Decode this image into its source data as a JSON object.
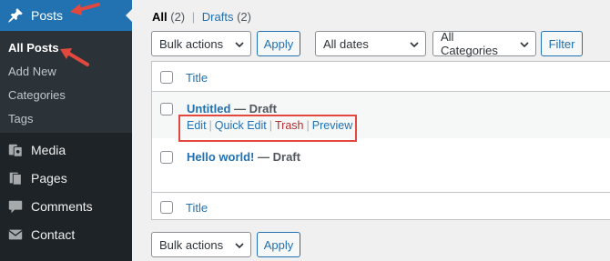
{
  "sidebar": {
    "posts": {
      "label": "Posts",
      "icon": "pushpin-icon"
    },
    "submenu": [
      {
        "label": "All Posts",
        "current": true
      },
      {
        "label": "Add New"
      },
      {
        "label": "Categories"
      },
      {
        "label": "Tags"
      }
    ],
    "items": [
      {
        "label": "Media",
        "icon": "media-icon"
      },
      {
        "label": "Pages",
        "icon": "pages-icon"
      },
      {
        "label": "Comments",
        "icon": "comment-icon"
      },
      {
        "label": "Contact",
        "icon": "mail-icon"
      }
    ]
  },
  "views": {
    "all": {
      "label": "All",
      "count": "(2)"
    },
    "separator": "|",
    "drafts": {
      "label": "Drafts",
      "count": "(2)"
    }
  },
  "filters": {
    "bulk_actions": "Bulk actions",
    "apply": "Apply",
    "dates": "All dates",
    "categories": "All Categories",
    "filter": "Filter"
  },
  "table": {
    "column_title": "Title",
    "rows": [
      {
        "title": "Untitled",
        "state": "— Draft",
        "actions": [
          "Edit",
          "Quick Edit",
          "Trash",
          "Preview"
        ]
      },
      {
        "title": "Hello world!",
        "state": "— Draft"
      }
    ],
    "footer_title": "Title"
  },
  "bottom": {
    "bulk_actions": "Bulk actions",
    "apply": "Apply"
  },
  "colors": {
    "sidebar_bg": "#1d2327",
    "submenu_bg": "#2c3338",
    "accent": "#2271b1",
    "trash": "#b32d2e",
    "annotation": "#e2483d"
  }
}
